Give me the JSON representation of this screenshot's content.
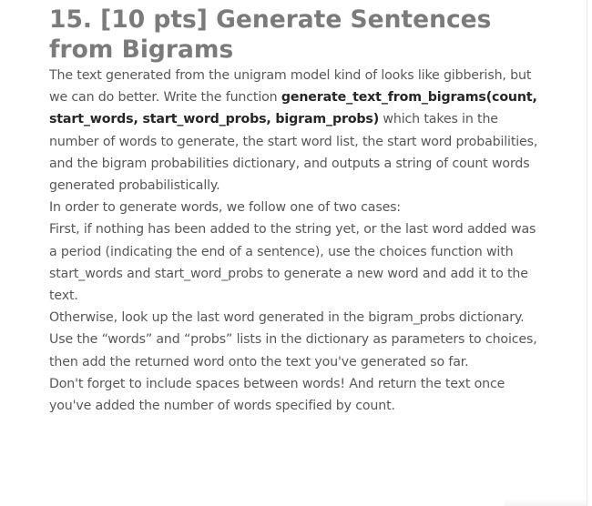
{
  "section": {
    "title": "15. [10 pts] Generate Sentences from Bigrams"
  },
  "paragraphs": {
    "p1": {
      "text_a": "The text generated from the unigram model kind of looks like gibberish, but we can do better. Write the function ",
      "bold_a": "generate_text_from_bigrams(count, start_words, start_word_probs, bigram_probs)",
      "text_b": " which takes in the number of words to generate, the start word list, the start word probabilities, and the bigram probabilities dictionary, and outputs a string of count words generated probabilistically."
    },
    "p2": "In order to generate words, we follow one of two cases:",
    "p3": "First, if nothing has been added to the string yet, or the last word added was a period (indicating the end of a sentence), use the choices function with start_words and start_word_probs to generate a new word and add it to the text.",
    "p4": "Otherwise, look up the last word generated in the bigram_probs dictionary. Use the “words” and “probs” lists in the dictionary as parameters to choices, then add the returned word onto the text you've generated so far.",
    "p5": "Don't forget to include spaces between words! And return the text once you've added the number of words specified by count."
  }
}
